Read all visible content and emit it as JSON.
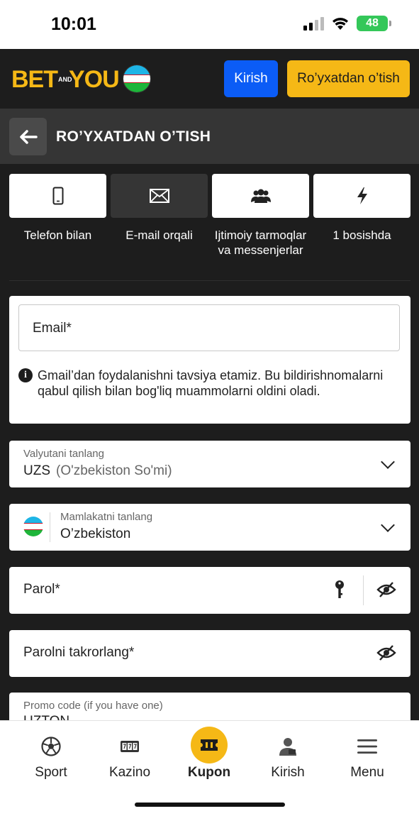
{
  "status_bar": {
    "time": "10:01",
    "battery": "48"
  },
  "header": {
    "logo_bet": "BET",
    "logo_and": "AND",
    "logo_you": "YOU",
    "login_label": "Kirish",
    "register_label": "Ro’yxatdan o’tish",
    "colors": {
      "brand_yellow": "#f5b816",
      "login_blue": "#0b5cf6",
      "background": "#1d1d1d"
    }
  },
  "title_bar": {
    "title": "RO’YXATDAN O’TISH"
  },
  "reg_tabs": [
    {
      "icon": "phone-icon",
      "label": "Telefon bilan",
      "active": false
    },
    {
      "icon": "envelope-icon",
      "label": "E-mail orqali",
      "active": true
    },
    {
      "icon": "people-icon",
      "label": "Ijtimoiy tarmoqlar va messenjerlar",
      "active": false
    },
    {
      "icon": "lightning-icon",
      "label": "1 bosishda",
      "active": false
    }
  ],
  "email_card": {
    "email_placeholder": "Email*",
    "info_text": "Gmail’dan foydalanishni tavsiya etamiz. Bu bildirishnomalarni qabul qilish bilan bog'liq muammolarni oldini oladi."
  },
  "currency": {
    "label": "Valyutani tanlang",
    "code": "UZS",
    "name": "(O'zbekiston So'mi)"
  },
  "country": {
    "label": "Mamlakatni tanlang",
    "value": "O’zbekiston"
  },
  "password": {
    "placeholder": "Parol*"
  },
  "password_repeat": {
    "placeholder": "Parolni takrorlang*"
  },
  "promo": {
    "label": "Promo code (if you have one)",
    "value": "UZTON"
  },
  "bottom_nav": {
    "sport": "Sport",
    "kazino": "Kazino",
    "kupon": "Kupon",
    "kirish": "Kirish",
    "menu": "Menu"
  }
}
